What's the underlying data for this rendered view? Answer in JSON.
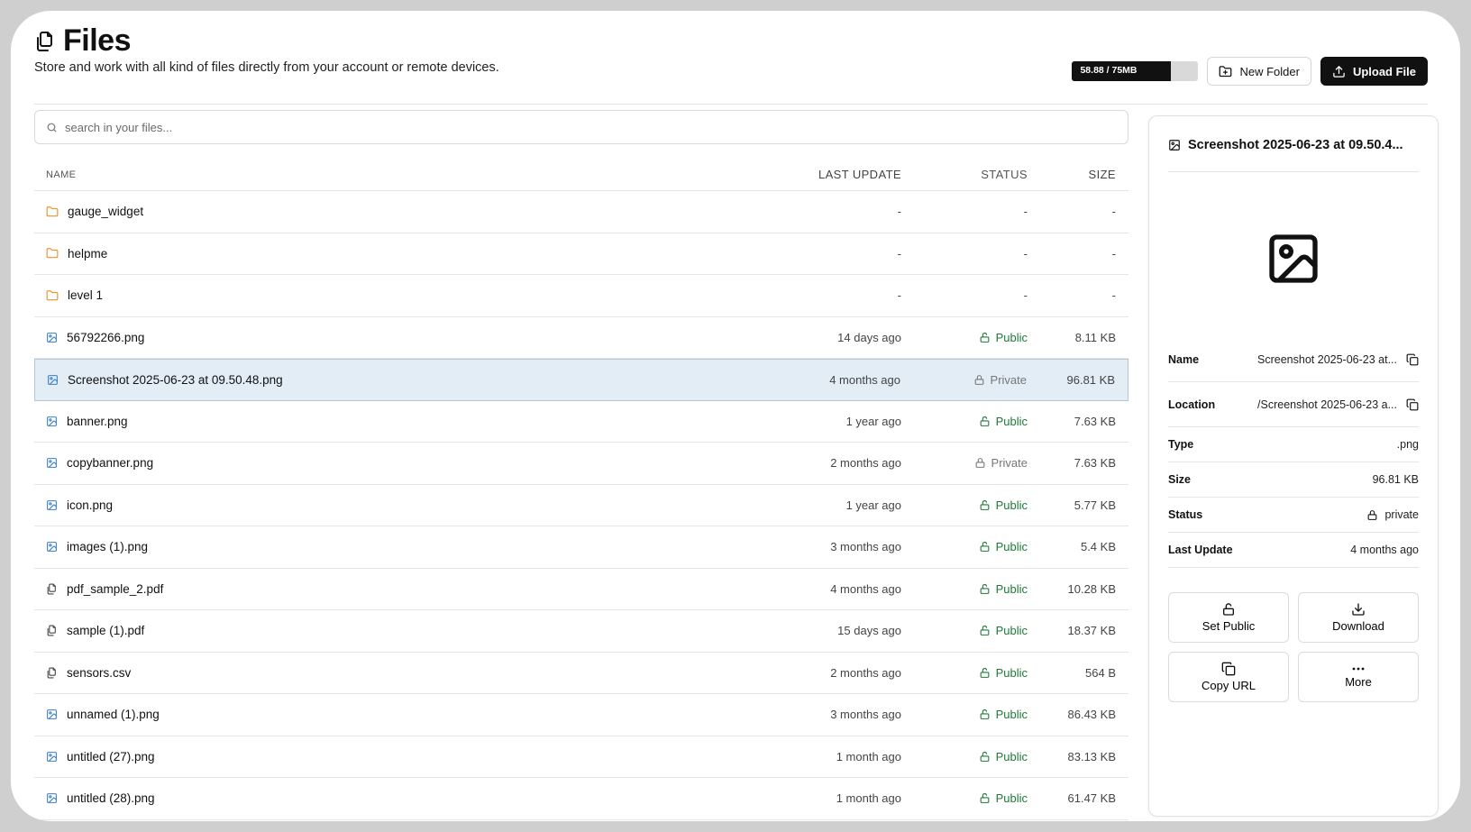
{
  "header": {
    "title": "Files",
    "subtitle": "Store and work with all kind of files directly from your account or remote devices.",
    "storage_text": "58.88 / 75MB",
    "storage_used_fraction": 0.785,
    "new_folder_label": "New Folder",
    "upload_label": "Upload File"
  },
  "search": {
    "placeholder": "search in your files..."
  },
  "table": {
    "columns": {
      "name": "NAME",
      "last_update": "LAST UPDATE",
      "status": "STATUS",
      "size": "SIZE"
    },
    "rows": [
      {
        "name": "gauge_widget",
        "type": "folder",
        "last_update": "-",
        "status": "-",
        "size": "-"
      },
      {
        "name": "helpme",
        "type": "folder",
        "last_update": "-",
        "status": "-",
        "size": "-"
      },
      {
        "name": "level 1",
        "type": "folder",
        "last_update": "-",
        "status": "-",
        "size": "-"
      },
      {
        "name": "56792266.png",
        "type": "image",
        "last_update": "14 days ago",
        "status": "Public",
        "size": "8.11 KB"
      },
      {
        "name": "Screenshot 2025-06-23 at 09.50.48.png",
        "type": "image",
        "last_update": "4 months ago",
        "status": "Private",
        "size": "96.81 KB",
        "selected": true
      },
      {
        "name": "banner.png",
        "type": "image",
        "last_update": "1 year ago",
        "status": "Public",
        "size": "7.63 KB"
      },
      {
        "name": "copybanner.png",
        "type": "image",
        "last_update": "2 months ago",
        "status": "Private",
        "size": "7.63 KB"
      },
      {
        "name": "icon.png",
        "type": "image",
        "last_update": "1 year ago",
        "status": "Public",
        "size": "5.77 KB"
      },
      {
        "name": "images (1).png",
        "type": "image",
        "last_update": "3 months ago",
        "status": "Public",
        "size": "5.4 KB"
      },
      {
        "name": "pdf_sample_2.pdf",
        "type": "file",
        "last_update": "4 months ago",
        "status": "Public",
        "size": "10.28 KB"
      },
      {
        "name": "sample (1).pdf",
        "type": "file",
        "last_update": "15 days ago",
        "status": "Public",
        "size": "18.37 KB"
      },
      {
        "name": "sensors.csv",
        "type": "file",
        "last_update": "2 months ago",
        "status": "Public",
        "size": "564 B"
      },
      {
        "name": "unnamed (1).png",
        "type": "image",
        "last_update": "3 months ago",
        "status": "Public",
        "size": "86.43 KB"
      },
      {
        "name": "untitled (27).png",
        "type": "image",
        "last_update": "1 month ago",
        "status": "Public",
        "size": "83.13 KB"
      },
      {
        "name": "untitled (28).png",
        "type": "image",
        "last_update": "1 month ago",
        "status": "Public",
        "size": "61.47 KB"
      }
    ]
  },
  "details": {
    "title": "Screenshot 2025-06-23 at 09.50.4...",
    "name_label": "Name",
    "name_value": "Screenshot 2025-06-23 at...",
    "location_label": "Location",
    "location_value": "/Screenshot 2025-06-23 a...",
    "type_label": "Type",
    "type_value": ".png",
    "size_label": "Size",
    "size_value": "96.81 KB",
    "status_label": "Status",
    "status_value": "private",
    "last_update_label": "Last Update",
    "last_update_value": "4 months ago",
    "actions": {
      "set_public": "Set Public",
      "download": "Download",
      "copy_url": "Copy URL",
      "more": "More"
    }
  },
  "colors": {
    "accent_dark": "#111111",
    "folder_icon": "#e8962f",
    "image_icon": "#3b7fc4",
    "public_status": "#1e7a38",
    "selected_row": "#e3edf6"
  }
}
